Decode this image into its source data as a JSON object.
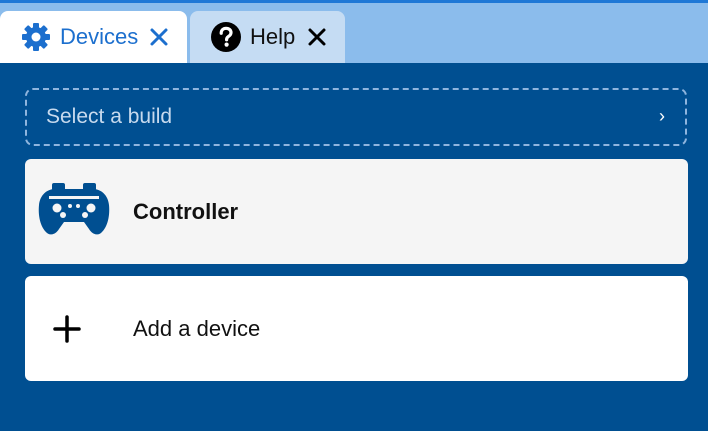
{
  "colors": {
    "accent": "#1c6fce",
    "panel_background": "#004f91",
    "tabbar_background": "#8bbcec"
  },
  "tabs": [
    {
      "label": "Devices",
      "icon": "gear-icon",
      "active": true
    },
    {
      "label": "Help",
      "icon": "question-circle-icon",
      "active": false
    }
  ],
  "build_selector": {
    "placeholder": "Select a build",
    "chevron": "›"
  },
  "devices": [
    {
      "label": "Controller",
      "icon": "gamepad-icon"
    }
  ],
  "add_device": {
    "label": "Add a device",
    "icon": "plus-icon"
  }
}
